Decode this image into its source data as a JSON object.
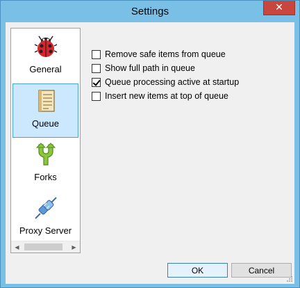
{
  "window": {
    "title": "Settings",
    "close_glyph": "✕"
  },
  "nav": {
    "items": [
      {
        "label": "General",
        "icon": "ladybug-icon",
        "selected": false
      },
      {
        "label": "Queue",
        "icon": "list-document-icon",
        "selected": true
      },
      {
        "label": "Forks",
        "icon": "fork-icon",
        "selected": false
      },
      {
        "label": "Proxy Server",
        "icon": "connector-plug-icon",
        "selected": false
      }
    ],
    "scroll_left": "◀",
    "scroll_right": "▶"
  },
  "options": [
    {
      "label": "Remove safe items from queue",
      "checked": false
    },
    {
      "label": "Show full path in queue",
      "checked": false
    },
    {
      "label": "Queue processing active at startup",
      "checked": true
    },
    {
      "label": "Insert new items at top of queue",
      "checked": false
    }
  ],
  "buttons": {
    "ok": "OK",
    "cancel": "Cancel"
  },
  "colors": {
    "title_bar": "#7ac0e6",
    "close_button": "#c7463d",
    "selection": "#cce8ff"
  }
}
